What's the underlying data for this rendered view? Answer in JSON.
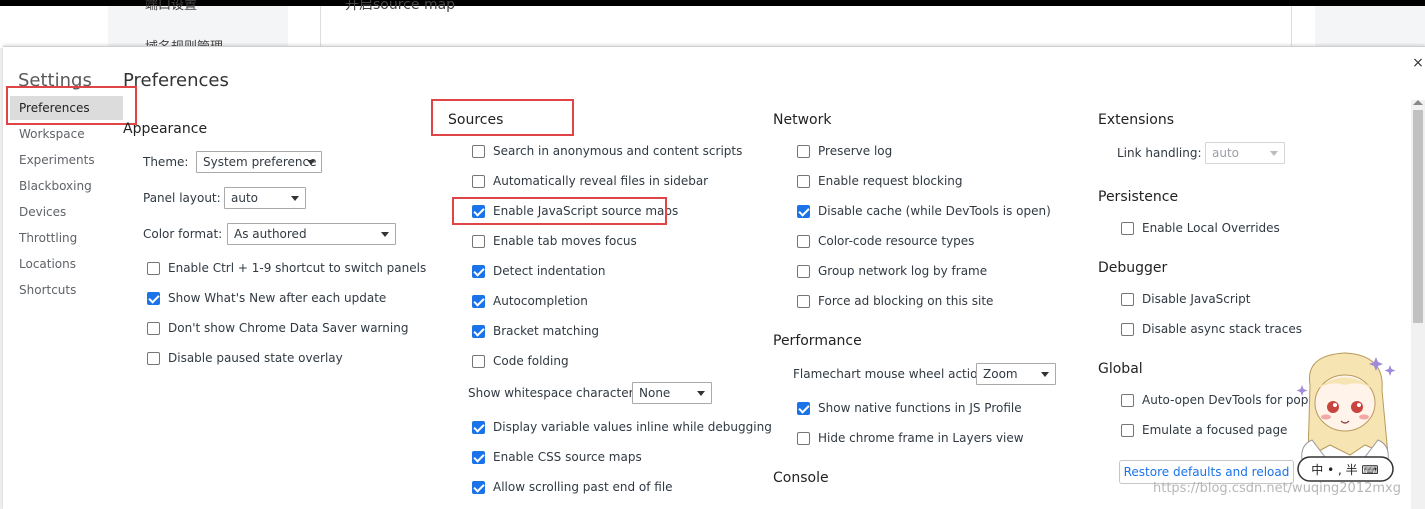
{
  "background": {
    "nav_items": [
      "端口设置",
      "域名规则管理"
    ],
    "content_text": "开启source map"
  },
  "settings": {
    "title": "Settings",
    "close_glyph": "×",
    "tabs": [
      {
        "label": "Preferences",
        "selected": true
      },
      {
        "label": "Workspace"
      },
      {
        "label": "Experiments"
      },
      {
        "label": "Blackboxing"
      },
      {
        "label": "Devices"
      },
      {
        "label": "Throttling"
      },
      {
        "label": "Locations"
      },
      {
        "label": "Shortcuts"
      }
    ]
  },
  "preferences": {
    "title": "Preferences",
    "appearance": {
      "title": "Appearance",
      "theme_label": "Theme:",
      "theme_value": "System preference",
      "panel_layout_label": "Panel layout:",
      "panel_layout_value": "auto",
      "color_format_label": "Color format:",
      "color_format_value": "As authored",
      "options": [
        {
          "label": "Enable Ctrl + 1-9 shortcut to switch panels",
          "checked": false
        },
        {
          "label": "Show What's New after each update",
          "checked": true
        },
        {
          "label": "Don't show Chrome Data Saver warning",
          "checked": false
        },
        {
          "label": "Disable paused state overlay",
          "checked": false
        }
      ]
    },
    "sources": {
      "title": "Sources",
      "options": [
        {
          "label": "Search in anonymous and content scripts",
          "checked": false
        },
        {
          "label": "Automatically reveal files in sidebar",
          "checked": false
        },
        {
          "label": "Enable JavaScript source maps",
          "checked": true
        },
        {
          "label": "Enable tab moves focus",
          "checked": false
        },
        {
          "label": "Detect indentation",
          "checked": true
        },
        {
          "label": "Autocompletion",
          "checked": true
        },
        {
          "label": "Bracket matching",
          "checked": true
        },
        {
          "label": "Code folding",
          "checked": false
        }
      ],
      "whitespace_label": "Show whitespace characters:",
      "whitespace_value": "None",
      "options2": [
        {
          "label": "Display variable values inline while debugging",
          "checked": true
        },
        {
          "label": "Enable CSS source maps",
          "checked": true
        },
        {
          "label": "Allow scrolling past end of file",
          "checked": true
        }
      ]
    },
    "network": {
      "title": "Network",
      "options": [
        {
          "label": "Preserve log",
          "checked": false
        },
        {
          "label": "Enable request blocking",
          "checked": false
        },
        {
          "label": "Disable cache (while DevTools is open)",
          "checked": true
        },
        {
          "label": "Color-code resource types",
          "checked": false
        },
        {
          "label": "Group network log by frame",
          "checked": false
        },
        {
          "label": "Force ad blocking on this site",
          "checked": false
        }
      ]
    },
    "performance": {
      "title": "Performance",
      "flamechart_label": "Flamechart mouse wheel action:",
      "flamechart_value": "Zoom",
      "options": [
        {
          "label": "Show native functions in JS Profile",
          "checked": true
        },
        {
          "label": "Hide chrome frame in Layers view",
          "checked": false
        }
      ]
    },
    "console": {
      "title": "Console"
    },
    "extensions": {
      "title": "Extensions",
      "link_handling_label": "Link handling:",
      "link_handling_value": "auto"
    },
    "persistence": {
      "title": "Persistence",
      "options": [
        {
          "label": "Enable Local Overrides",
          "checked": false
        }
      ]
    },
    "debugger": {
      "title": "Debugger",
      "options": [
        {
          "label": "Disable JavaScript",
          "checked": false
        },
        {
          "label": "Disable async stack traces",
          "checked": false
        }
      ]
    },
    "global": {
      "title": "Global",
      "options": [
        {
          "label": "Auto-open DevTools for popups",
          "checked": false
        },
        {
          "label": "Emulate a focused page",
          "checked": false
        }
      ]
    },
    "restore_label": "Restore defaults and reload"
  },
  "mascot": {
    "badge_text": "中 • , 半 ⌨"
  },
  "watermark": "https://blog.csdn.net/wuqing2012mxg",
  "colors": {
    "checkbox_checked": "#1a73e8",
    "highlight_box": "#e04444",
    "link_blue": "#1a73e8"
  }
}
